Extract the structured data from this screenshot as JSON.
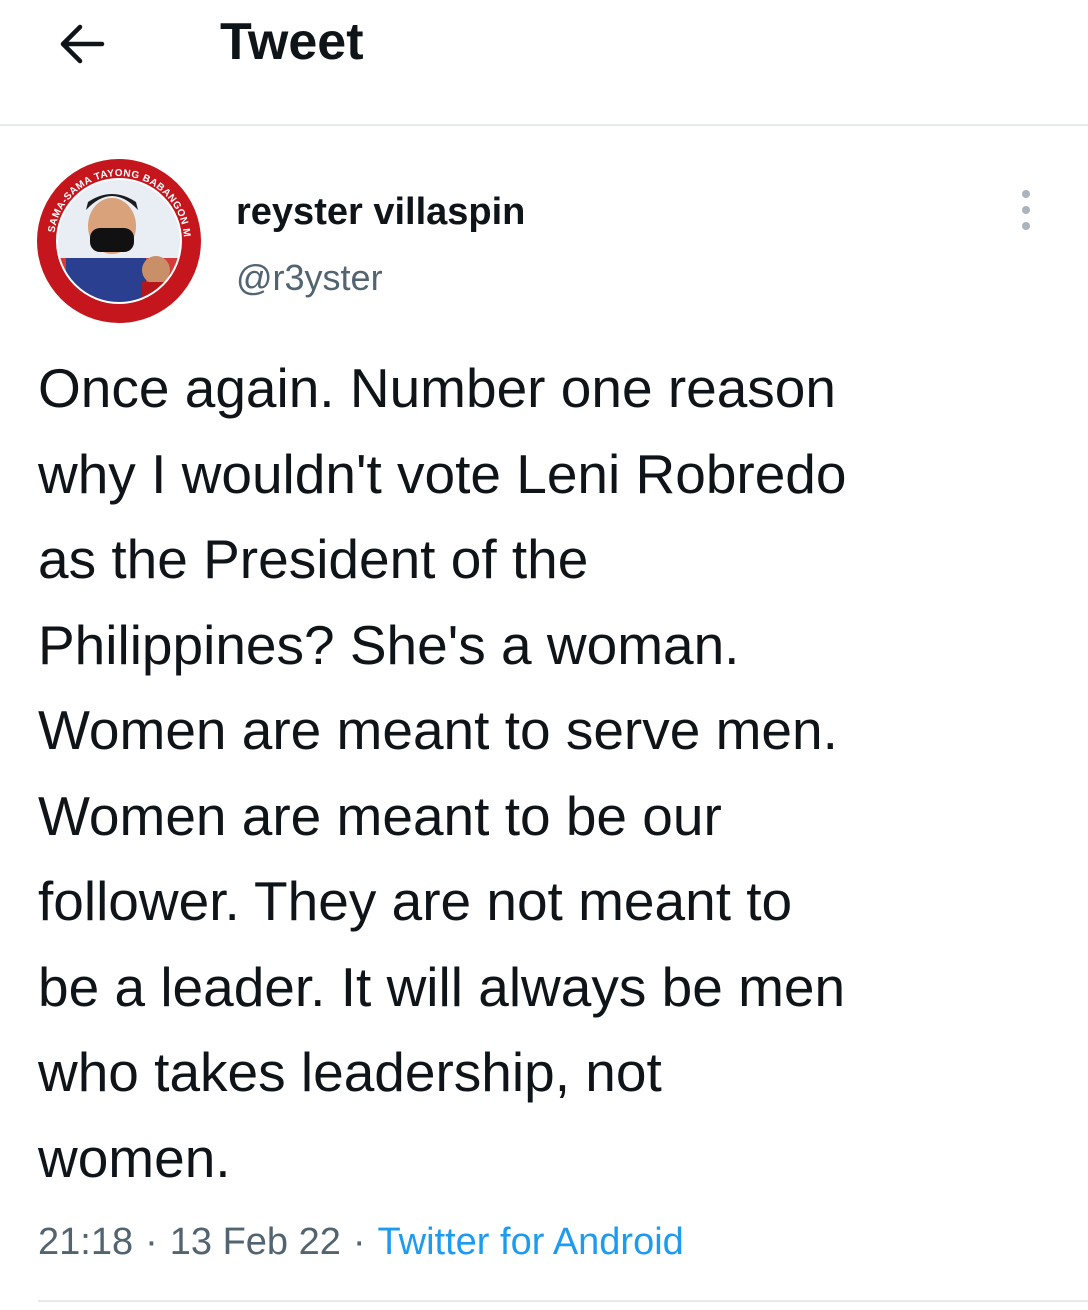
{
  "header": {
    "title": "Tweet",
    "back_icon": "arrow-left-icon"
  },
  "author": {
    "name": "reyster villaspin",
    "handle": "@r3yster",
    "avatar_ring_text": "SAMA-SAMA TAYONG BABANGON MULI",
    "more_icon": "more-vertical-icon"
  },
  "tweet": {
    "text": "Once again. Number one reason\nwhy I wouldn't vote Leni Robredo\nas the President of the\nPhilippines? She's a woman.\nWomen are meant to serve men.\nWomen are meant to be our\nfollower. They are not meant to\nbe a leader. It will always be men\nwho takes leadership, not\nwomen.",
    "time": "21:18",
    "date": "13 Feb 22",
    "separator": "·",
    "source": "Twitter for Android"
  },
  "colors": {
    "text": "#0f1419",
    "secondary": "#536471",
    "link": "#1d9bf0",
    "divider": "#e6e9ec",
    "avatar_ring": "#c4161c"
  }
}
